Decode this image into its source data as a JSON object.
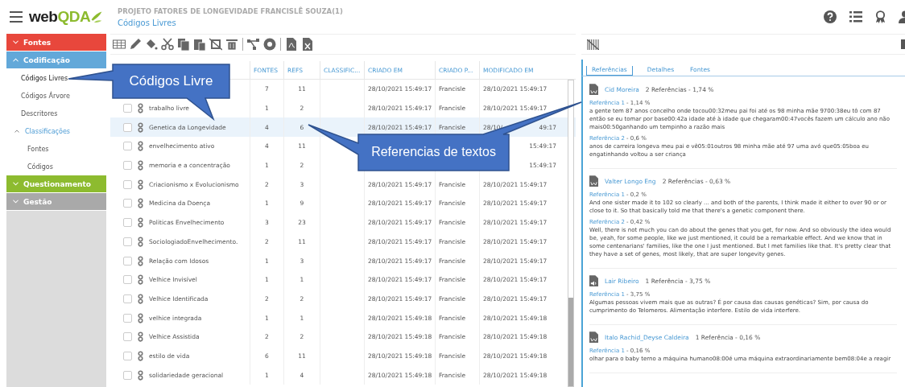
{
  "logo": {
    "prefix": "web",
    "suffix": "QDA"
  },
  "header": {
    "project": "PROJETO FATORES DE LONGEVIDADE FRANCISLÊ SOUZA(1)",
    "page": "Códigos Livres"
  },
  "sidebar": [
    {
      "label": "Fontes",
      "kind": "section",
      "color": "#e8473c",
      "expanded": false
    },
    {
      "label": "Codificação",
      "kind": "section",
      "color": "#62a8d9",
      "expanded": true
    },
    {
      "label": "Códigos Livres",
      "kind": "item",
      "selected": true
    },
    {
      "label": "Códigos Árvore",
      "kind": "item",
      "selected": false
    },
    {
      "label": "Descritores",
      "kind": "item",
      "selected": false
    },
    {
      "label": "Classificações",
      "kind": "group",
      "expanded": true
    },
    {
      "label": "Fontes",
      "kind": "subitem",
      "selected": false
    },
    {
      "label": "Códigos",
      "kind": "subitem",
      "selected": false
    },
    {
      "label": "Questionamento",
      "kind": "section",
      "color": "#8dbb2f",
      "expanded": false
    },
    {
      "label": "Gestão",
      "kind": "section",
      "color": "#a9a9a9",
      "expanded": false
    }
  ],
  "table": {
    "columns": [
      "FONTES",
      "REFS",
      "CLASSIFIC...",
      "CRIADO EM",
      "CRIADO P...",
      "MODIFICADO EM"
    ],
    "rows": [
      {
        "fontes": "7",
        "refs": "11",
        "criado_em": "28/10/2021 15:49:17",
        "criado_por": "Francisle",
        "modificado": "28/10/2021 15:49:17",
        "selected": false
      },
      {
        "name": "trabalho livre",
        "checked": false,
        "fontes": "1",
        "refs": "2",
        "criado_em": "28/10/2021 15:49:17",
        "criado_por": "Francisle",
        "modificado": "28/10/2021 15:49:17",
        "selected": false
      },
      {
        "name": "Genetica da Longevidade",
        "checked": false,
        "fontes": "4",
        "refs": "6",
        "criado_em": "28/10/2021 15:49:17",
        "criado_por": "Francisle",
        "modificado": "28/10/",
        "modificado_end": "49:17",
        "selected": true
      },
      {
        "name": "envelhecimento ativo",
        "checked": false,
        "fontes": "4",
        "refs": "11",
        "modificado_end": "15:49:17",
        "selected": false
      },
      {
        "name": "memoria e a concentração",
        "checked": false,
        "fontes": "1",
        "refs": "2",
        "modificado_end": "15:49:17",
        "selected": false
      },
      {
        "name": "Criacionismo x Evolucionismo",
        "checked": false,
        "fontes": "2",
        "refs": "3",
        "criado_em": "28/10/2021 15:49:17",
        "criado_por": "Francisle",
        "modificado": "28/10/2021 15:49:17",
        "selected": false
      },
      {
        "name": "Medicina da Doença",
        "checked": false,
        "fontes": "1",
        "refs": "9",
        "criado_em": "28/10/2021 15:49:17",
        "criado_por": "Francisle",
        "modificado": "28/10/2021 15:49:17",
        "selected": false
      },
      {
        "name": "Politicas Envelhecimento",
        "checked": false,
        "fontes": "3",
        "refs": "23",
        "criado_em": "28/10/2021 15:49:17",
        "criado_por": "Francisle",
        "modificado": "28/10/2021 15:49:17",
        "selected": false
      },
      {
        "name": "SociologiadoEnvelhecimento.",
        "checked": false,
        "fontes": "2",
        "refs": "11",
        "criado_em": "28/10/2021 15:49:17",
        "criado_por": "Francisle",
        "modificado": "28/10/2021 15:49:17",
        "selected": false
      },
      {
        "name": "Relação com Idosos",
        "checked": false,
        "fontes": "1",
        "refs": "3",
        "criado_em": "28/10/2021 15:49:17",
        "criado_por": "Francisle",
        "modificado": "28/10/2021 15:49:17",
        "selected": false
      },
      {
        "name": "Velhice Invisível",
        "checked": false,
        "fontes": "1",
        "refs": "1",
        "criado_em": "28/10/2021 15:49:17",
        "criado_por": "Francisle",
        "modificado": "28/10/2021 15:49:17",
        "selected": false
      },
      {
        "name": "Velhice Identificada",
        "checked": false,
        "fontes": "2",
        "refs": "2",
        "criado_em": "28/10/2021 15:49:17",
        "criado_por": "Francisle",
        "modificado": "28/10/2021 15:49:17",
        "selected": false
      },
      {
        "name": "velhice integrada",
        "checked": false,
        "fontes": "1",
        "refs": "1",
        "criado_em": "28/10/2021 15:49:18",
        "criado_por": "Francisle",
        "modificado": "28/10/2021 15:49:18",
        "selected": false
      },
      {
        "name": "Velhice Assistida",
        "checked": false,
        "fontes": "2",
        "refs": "2",
        "criado_em": "28/10/2021 15:49:18",
        "criado_por": "Francisle",
        "modificado": "28/10/2021 15:49:18",
        "selected": false
      },
      {
        "name": "estilo de vida",
        "checked": false,
        "fontes": "6",
        "refs": "11",
        "criado_em": "28/10/2021 15:49:18",
        "criado_por": "Francisle",
        "modificado": "28/10/2021 15:49:18",
        "selected": false
      },
      {
        "name": "solidariedade geracional",
        "checked": false,
        "fontes": "1",
        "refs": "4",
        "criado_em": "28/10/2021 15:49:18",
        "criado_por": "Francisle",
        "modificado": "28/10/2021 15:49:18",
        "selected": false
      }
    ]
  },
  "panel": {
    "tabs": [
      {
        "label": "Referências",
        "selected": true
      },
      {
        "label": "Detalhes",
        "selected": false
      },
      {
        "label": "Fontes",
        "selected": false
      }
    ],
    "sources": [
      {
        "name": "Cid Moreira",
        "kind": "word",
        "summary": "2 Referências - 1,74 %",
        "refs": [
          {
            "label": "Referência 1",
            "pct": " - 1,14 %",
            "text": "a gente tem 87 anos concelho onde tocou00:32meu pai foi até os 98 minha mãe 9700:38eu tô com 87 então se eu tomar por base00:42a idade até à idade que chegaram00:47vocês fazem um cálculo ano não mais00:50ganhando um tempinho a razão mais"
          },
          {
            "label": "Referência 2",
            "pct": " - 0,6 %",
            "text": "anos de carreira longeva meu pai e vê05:01outros 98 minha mãe até 97 uma avó que05:05boa eu engatinhando voltou a ser criança"
          }
        ]
      },
      {
        "name": "Valter Longo Eng",
        "kind": "word",
        "summary": "2 Referências - 0,63 %",
        "refs": [
          {
            "label": "Referência 1",
            "pct": " - 0,2 %",
            "text": "And one sister made it to 102 so clearly ... and both of the parents, I think made it either to over 90 or or close to it. So that basically told me that there's a genetic component there."
          },
          {
            "label": "Referência 2",
            "pct": " - 0,42 %",
            "text": "Well, there is not much you can do about the genes that you get, for now. And so obviously the idea would be, yeah, for some people, like we just mentioned, it could be a remarkable effect. And we know that in some centenarians' families, like the one I just mentioned. But I met families like that. It's pretty clear that they have a set of genes, most likely, that are super longevity genes."
          }
        ]
      },
      {
        "name": "Lair Ribeiro",
        "kind": "audio",
        "summary": "1 Referência - 3,75 %",
        "refs": [
          {
            "label": "Referência 1",
            "pct": " - 3,75 %",
            "text": "Algumas pessoas vivem mais que as outras? É por causa das causas genéticas? Sim, por causa do cumprimento do Telomeros. Alimentação interfere. Estilo de vida interfere."
          }
        ]
      },
      {
        "name": "Italo Rachid_Deyse Caldeira",
        "kind": "word",
        "summary": "1 Referência - 0,16 %",
        "refs": [
          {
            "label": "Referência 1",
            "pct": " - 0,16 %",
            "text": "olhar para o baby terno a máquina humano08:00é uma máquina extraordinariamente bem08:04e a reagir"
          }
        ]
      }
    ]
  },
  "callouts": [
    {
      "text": "Códigos Livre"
    },
    {
      "text": "Referencias de textos"
    }
  ]
}
